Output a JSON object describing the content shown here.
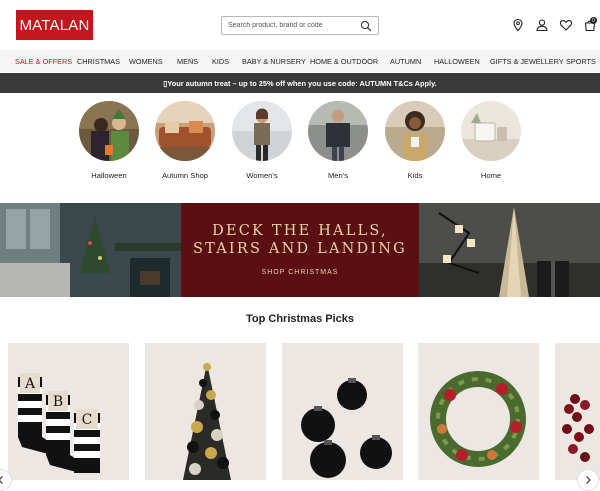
{
  "header": {
    "logo_text": "MATALAN",
    "search_placeholder": "Search product, brand or code",
    "basket_count": "0"
  },
  "nav": {
    "items": [
      "SALE & OFFERS",
      "CHRISTMAS",
      "WOMENS",
      "MENS",
      "KIDS",
      "BABY & NURSERY",
      "HOME & OUTDOOR",
      "AUTUMN",
      "HALLOWEEN",
      "GIFTS & JEWELLERY",
      "SPORTS"
    ]
  },
  "promo": {
    "text": "▯Your autumn treat – up to 25% off when you use code: AUTUMN T&Cs Apply."
  },
  "categories": [
    {
      "label": "Halloween"
    },
    {
      "label": "Autumn Shop"
    },
    {
      "label": "Women's"
    },
    {
      "label": "Men's"
    },
    {
      "label": "Kids"
    },
    {
      "label": "Home"
    }
  ],
  "banner": {
    "line1": "DECK THE HALLS,",
    "line2": "STAIRS AND LANDING",
    "cta": "SHOP CHRISTMAS"
  },
  "section": {
    "title": "Top Christmas Picks"
  },
  "products": [
    {
      "name": "monogram-stockings"
    },
    {
      "name": "bauble-tree"
    },
    {
      "name": "black-baubles"
    },
    {
      "name": "wreath"
    },
    {
      "name": "bead-garland"
    }
  ],
  "colors": {
    "brand": "#c4161c",
    "promo_bg": "#3a3a3a",
    "banner_bg": "#5a0f12",
    "banner_text": "#e9d3a6"
  }
}
